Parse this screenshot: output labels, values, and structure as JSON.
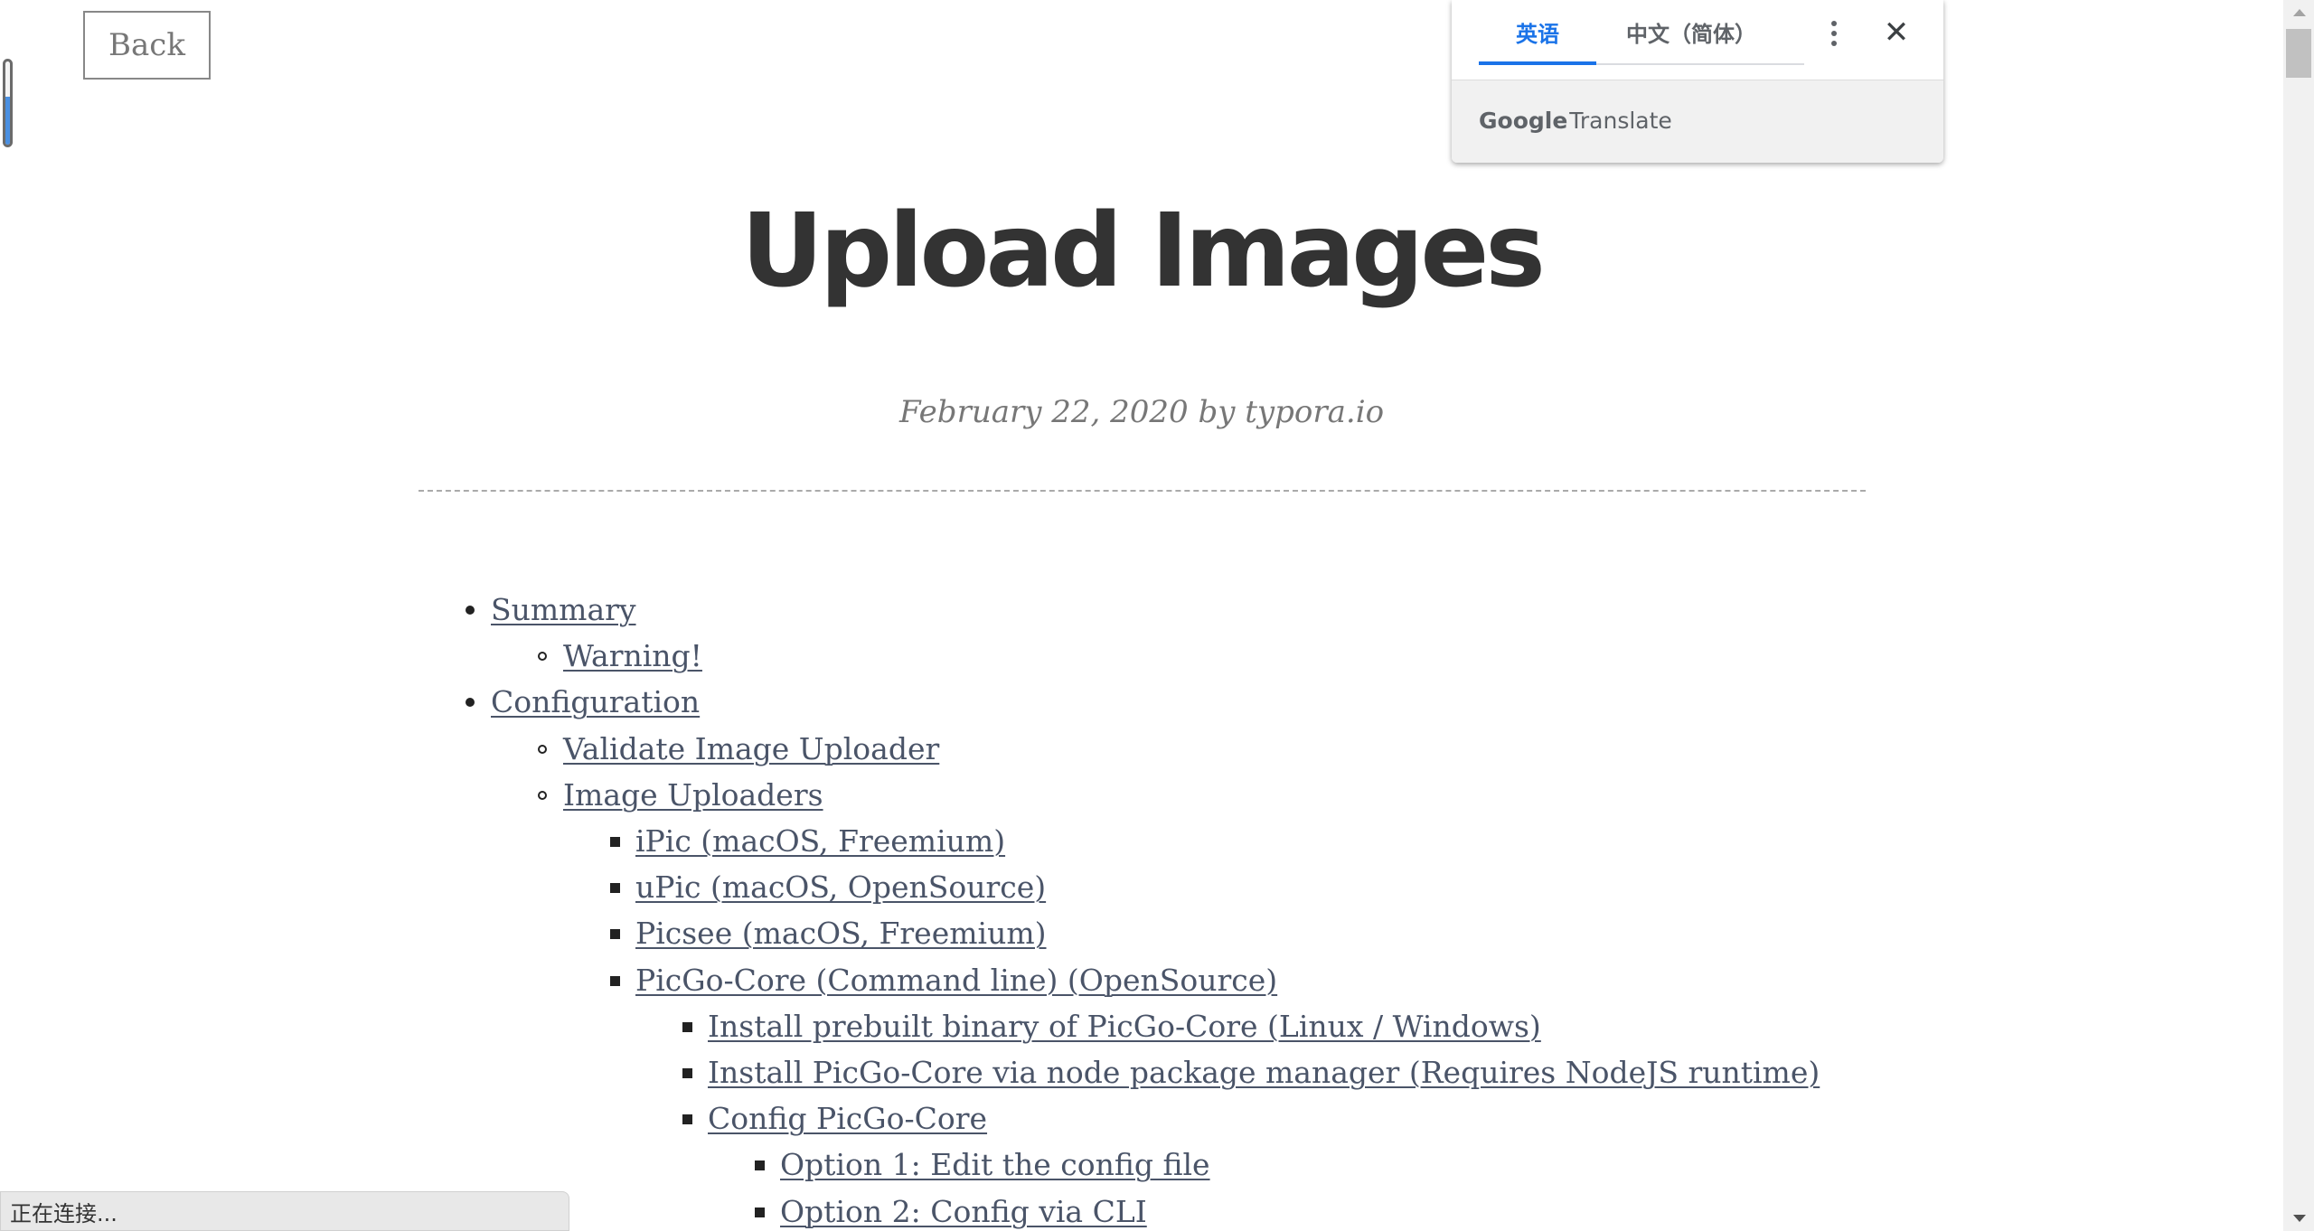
{
  "back_button": {
    "label": "Back"
  },
  "loading_progress": {
    "value": 0.58
  },
  "title": "Upload Images",
  "meta": "February 22, 2020 by typora.io",
  "toc": [
    {
      "label": "Summary",
      "level": 0
    },
    {
      "label": "Warning!",
      "level": 1
    },
    {
      "label": "Configuration",
      "level": 0
    },
    {
      "label": "Validate Image Uploader",
      "level": 1
    },
    {
      "label": "Image Uploaders",
      "level": 1
    },
    {
      "label": "iPic (macOS, Freemium)",
      "level": 2
    },
    {
      "label": "uPic (macOS, OpenSource)",
      "level": 2
    },
    {
      "label": "Picsee (macOS, Freemium)",
      "level": 2
    },
    {
      "label": "PicGo-Core (Command line) (OpenSource)",
      "level": 2
    },
    {
      "label": "Install prebuilt binary of PicGo-Core (Linux / Windows)",
      "level": 3
    },
    {
      "label": "Install PicGo-Core via node package manager (Requires NodeJS runtime)",
      "level": 3
    },
    {
      "label": "Config PicGo-Core",
      "level": 3
    },
    {
      "label": "Option 1: Edit the config file",
      "level": 4
    },
    {
      "label": "Option 2: Config via CLI",
      "level": 4
    }
  ],
  "translate": {
    "tab_source": "英语",
    "tab_target": "中文（简体）",
    "brand_google": "Google",
    "brand_translate": "Translate",
    "more_icon": "vertical-dots-icon",
    "close_icon": "close-icon",
    "accent_color": "#1a73e8"
  },
  "status": "正在连接..."
}
